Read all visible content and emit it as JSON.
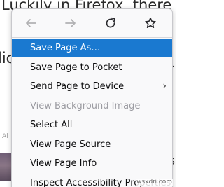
{
  "background": {
    "line_1": "Luckily in Firefox, there is a qu",
    "line_2": "lic",
    "fragment_1": "·",
    "fragment_2": "s",
    "small_left": "Al",
    "watermark": "wsxdn.com"
  },
  "nav": {
    "back_icon": "arrow-left-icon",
    "forward_icon": "arrow-right-icon",
    "reload_icon": "reload-icon",
    "bookmark_icon": "star-icon",
    "back_enabled": false,
    "forward_enabled": false
  },
  "menu": {
    "items": [
      {
        "label": "Save Page As…",
        "state": "highlighted"
      },
      {
        "label": "Save Page to Pocket",
        "state": "normal"
      },
      {
        "label": "Send Page to Device",
        "state": "normal",
        "submenu_icon": "chevron-right-icon"
      },
      {
        "label": "View Background Image",
        "state": "disabled"
      },
      {
        "label": "Select All",
        "state": "normal"
      },
      {
        "label": "View Page Source",
        "state": "normal"
      },
      {
        "label": "View Page Info",
        "state": "normal"
      },
      {
        "label": "Inspect Accessibility Properties",
        "state": "normal"
      }
    ],
    "submenu_arrow": "›"
  },
  "colors": {
    "highlight": "#1a79d0",
    "menu_bg": "#f9f9fa",
    "disabled_text": "#9c9ca2"
  }
}
